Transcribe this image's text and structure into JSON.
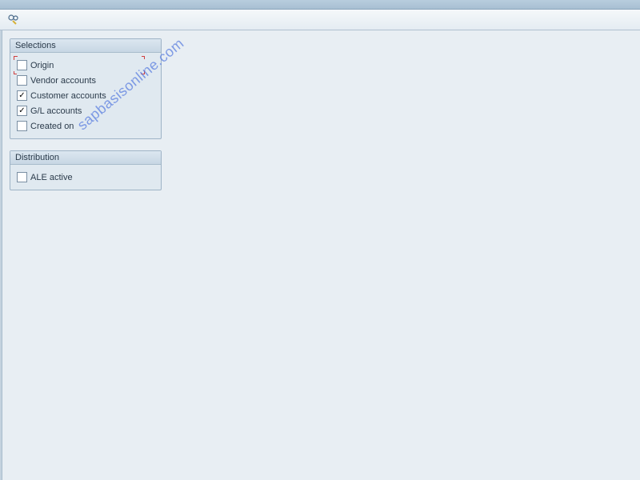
{
  "toolbar": {
    "execute_icon": "execute-object-icon"
  },
  "groups": {
    "selections": {
      "title": "Selections",
      "items": [
        {
          "label": "Origin",
          "checked": false,
          "focused": true
        },
        {
          "label": "Vendor accounts",
          "checked": false,
          "focused": false
        },
        {
          "label": "Customer accounts",
          "checked": true,
          "focused": false
        },
        {
          "label": "G/L accounts",
          "checked": true,
          "focused": false
        },
        {
          "label": "Created on",
          "checked": false,
          "focused": false
        }
      ]
    },
    "distribution": {
      "title": "Distribution",
      "items": [
        {
          "label": "ALE active",
          "checked": false
        }
      ]
    }
  },
  "watermark": "sapbasisonline.com"
}
